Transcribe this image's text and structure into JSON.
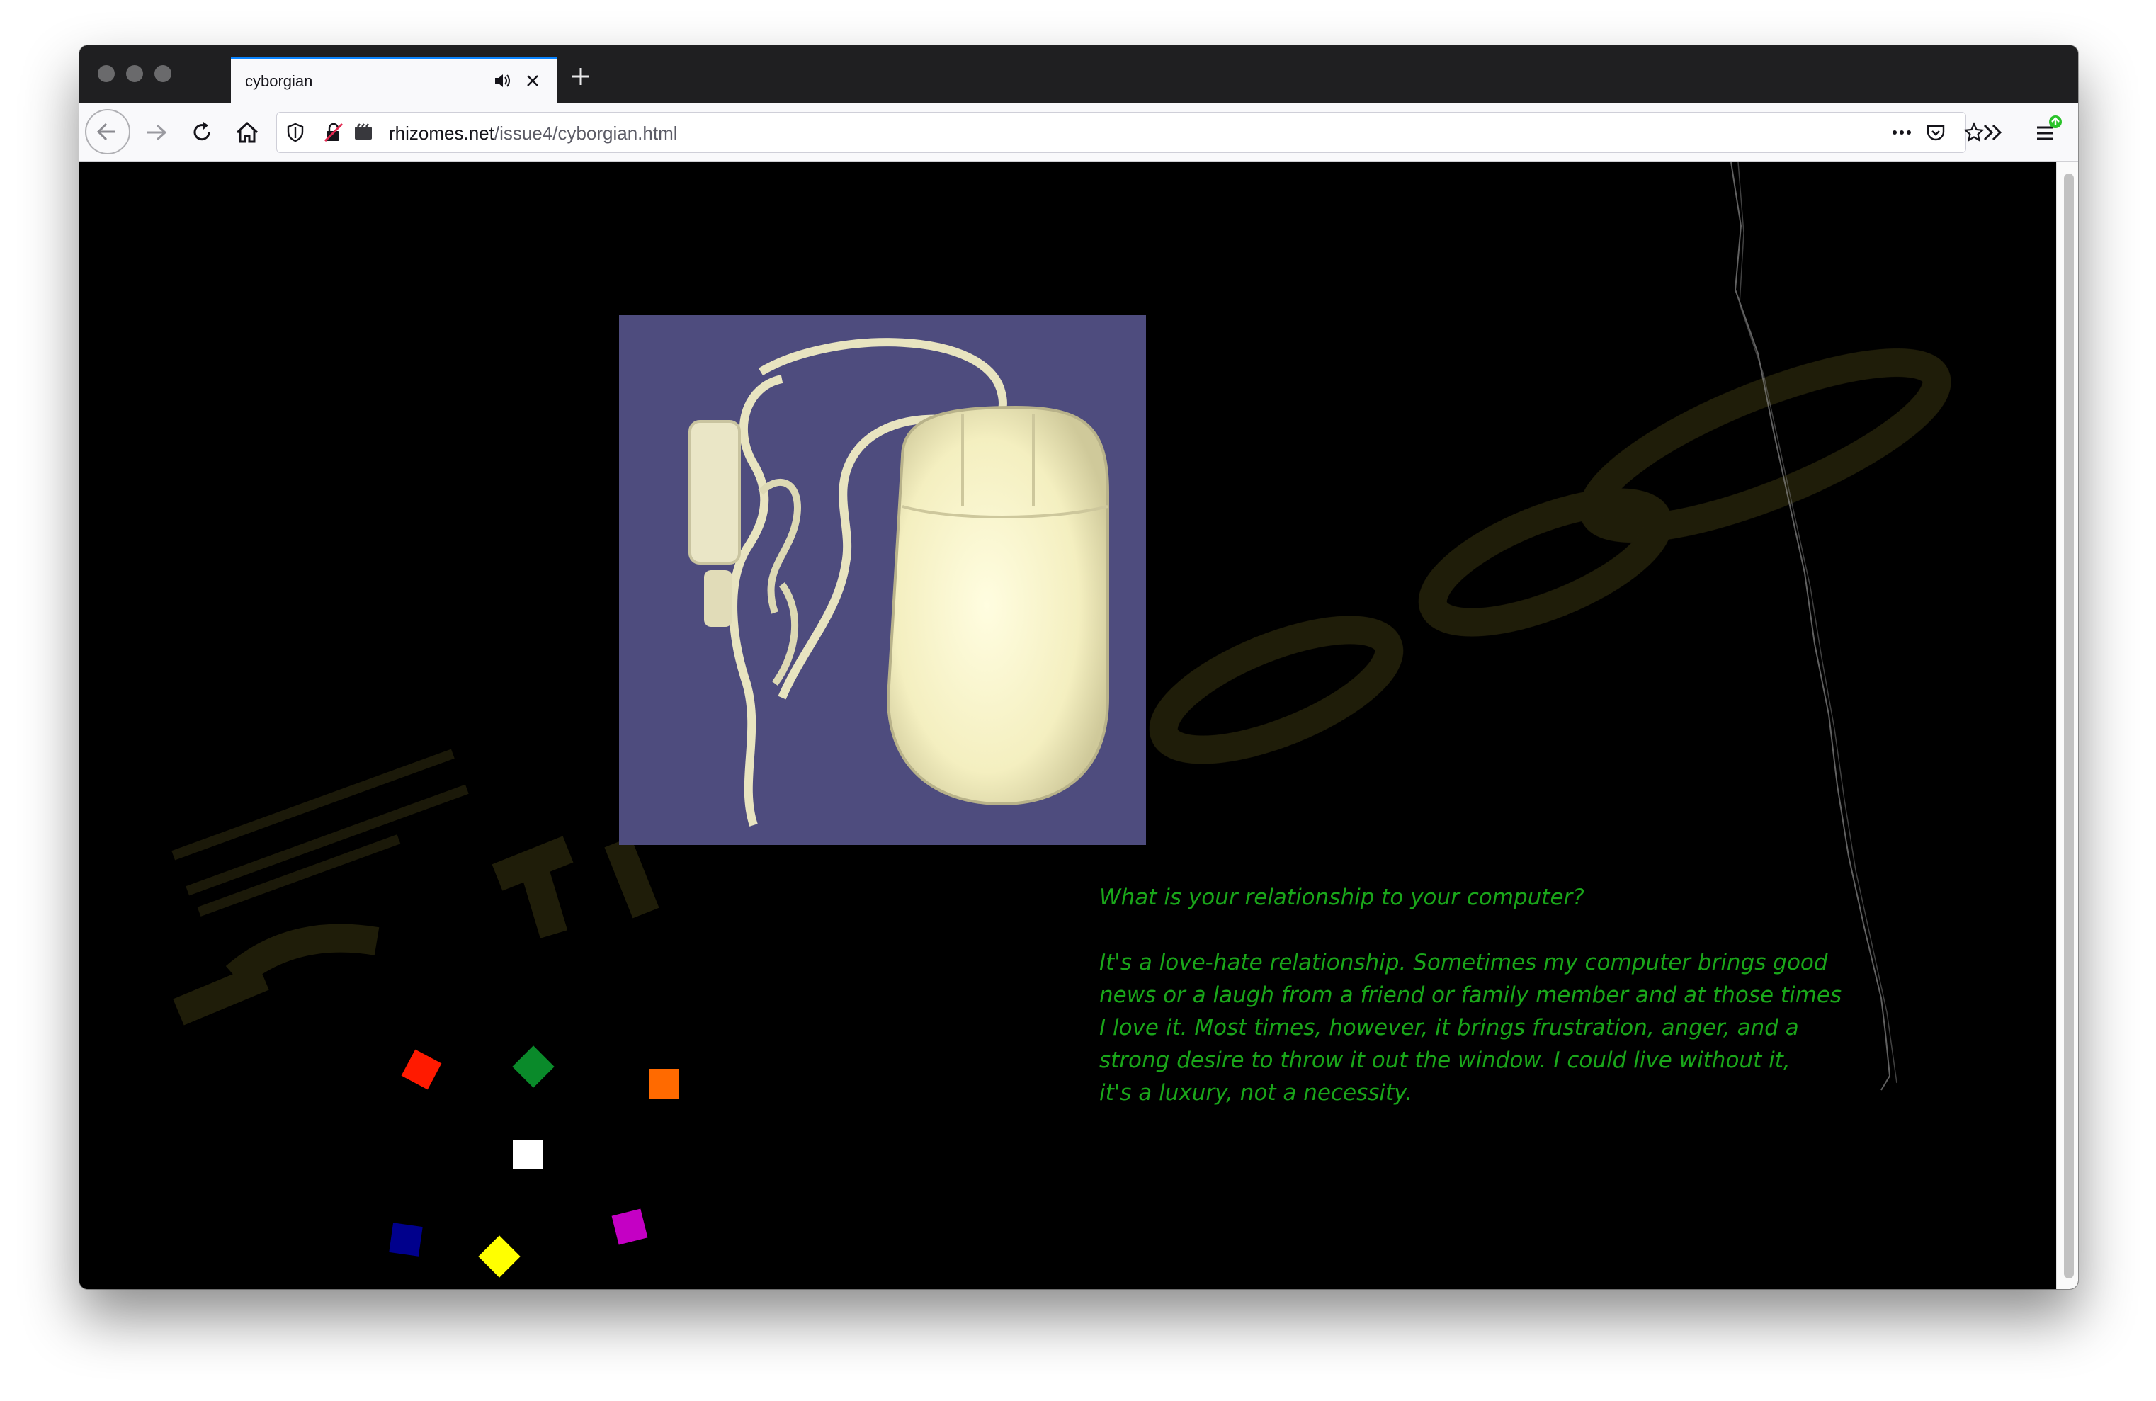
{
  "browser": {
    "tab": {
      "title": "cyborgian"
    },
    "url": {
      "domain": "rhizomes.net",
      "path": "/issue4/cyborgian.html"
    }
  },
  "page": {
    "question": "What is your relationship to your computer?",
    "answer_lines": [
      "It's a love-hate relationship.  Sometimes my computer brings good",
      "news or a laugh from a friend or family member and at those times",
      "I love it.  Most times, however, it brings frustration, anger, and a",
      "strong desire to throw it out the window.  I could live without it,",
      "it's a luxury, not a necessity."
    ],
    "image_alt": "computer mouse",
    "shapes": [
      {
        "name": "red-square",
        "color": "#ff1a00"
      },
      {
        "name": "green-diamond",
        "color": "#0a8a2a"
      },
      {
        "name": "orange-square",
        "color": "#ff6a00"
      },
      {
        "name": "white-square",
        "color": "#ffffff"
      },
      {
        "name": "blue-square",
        "color": "#00008c"
      },
      {
        "name": "yellow-diamond",
        "color": "#ffff00"
      },
      {
        "name": "magenta-square",
        "color": "#c400c4"
      }
    ]
  },
  "colors": {
    "text_green": "#1aa61a",
    "accent_tab": "#0a84ff"
  }
}
